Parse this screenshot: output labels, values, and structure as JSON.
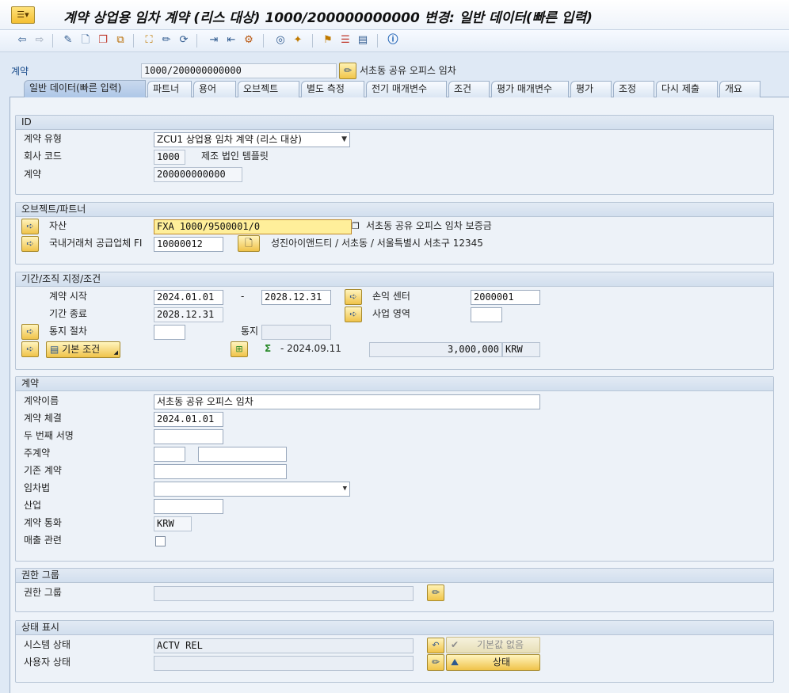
{
  "window": {
    "title": "계약 상업용 임차 계약 (리스 대상) 1000/200000000000 변경: 일반 데이터(빠른 입력)"
  },
  "header": {
    "contract_label": "계약",
    "contract_value": "1000/200000000000",
    "contract_desc": "서초동 공유 오피스 임차"
  },
  "tabs": [
    "일반 데이터(빠른 입력)",
    "파트너",
    "용어",
    "오브젝트",
    "별도 측정",
    "전기 매개변수",
    "조건",
    "평가 매개변수",
    "평가",
    "조정",
    "다시 제출",
    "개요"
  ],
  "id_group": {
    "title": "ID",
    "type_label": "계약 유형",
    "type_value": "ZCU1 상업용 임차 계약 (리스 대상)",
    "company_label": "회사 코드",
    "company_value": "1000",
    "company_desc": "제조 법인 템플릿",
    "contract_label": "계약",
    "contract_value": "200000000000"
  },
  "object_group": {
    "title": "오브젝트/파트너",
    "asset_label": "자산",
    "asset_value": "FXA 1000/9500001/0",
    "asset_desc": "서초동 공유 오피스 임차 보증금",
    "vendor_label": "국내거래처 공급업체 FI",
    "vendor_value": "10000012",
    "vendor_desc": "성진아이앤드티 / 서초동 / 서울특별시 서초구 12345"
  },
  "period_group": {
    "title": "기간/조직 지정/조건",
    "start_label": "계약 시작",
    "start_value": "2024.01.01",
    "dash": "-",
    "end_value": "2028.12.31",
    "profit_label": "손익 센터",
    "profit_value": "2000001",
    "term_end_label": "기간 종료",
    "term_end_value": "2028.12.31",
    "biz_label": "사업 영역",
    "biz_value": "",
    "notice_label": "통지 절차",
    "notice_value": "",
    "notify_label": "통지",
    "notify_value": "",
    "basic_cond_label": "기본 조건",
    "cond_date": "- 2024.09.11",
    "cond_amount": "3,000,000",
    "cond_currency": "KRW"
  },
  "contract_group": {
    "title": "계약",
    "name_label": "계약이름",
    "name_value": "서초동 공유 오피스 임차",
    "conclusion_label": "계약 체결",
    "conclusion_value": "2024.01.01",
    "second_sig_label": "두 번째 서명",
    "second_sig_value": "",
    "main_contract_label": "주계약",
    "main_contract_value1": "",
    "main_contract_value2": "",
    "old_contract_label": "기존 계약",
    "old_contract_value": "",
    "tenancy_law_label": "임차법",
    "tenancy_law_value": "",
    "industry_label": "산업",
    "industry_value": "",
    "currency_label": "계약 통화",
    "currency_value": "KRW",
    "sales_label": "매출 관련",
    "sales_checked": false
  },
  "auth_group": {
    "title": "권한 그룹",
    "label": "권한 그룹",
    "value": ""
  },
  "status_group": {
    "title": "상태 표시",
    "system_label": "시스템 상태",
    "system_value": "ACTV  REL",
    "user_label": "사용자 상태",
    "user_value": "",
    "no_default_label": "기본값 없음",
    "status_label": "상태"
  },
  "icons": {
    "accent": "#f1c54a",
    "panel_bg": "#edf2f8"
  }
}
